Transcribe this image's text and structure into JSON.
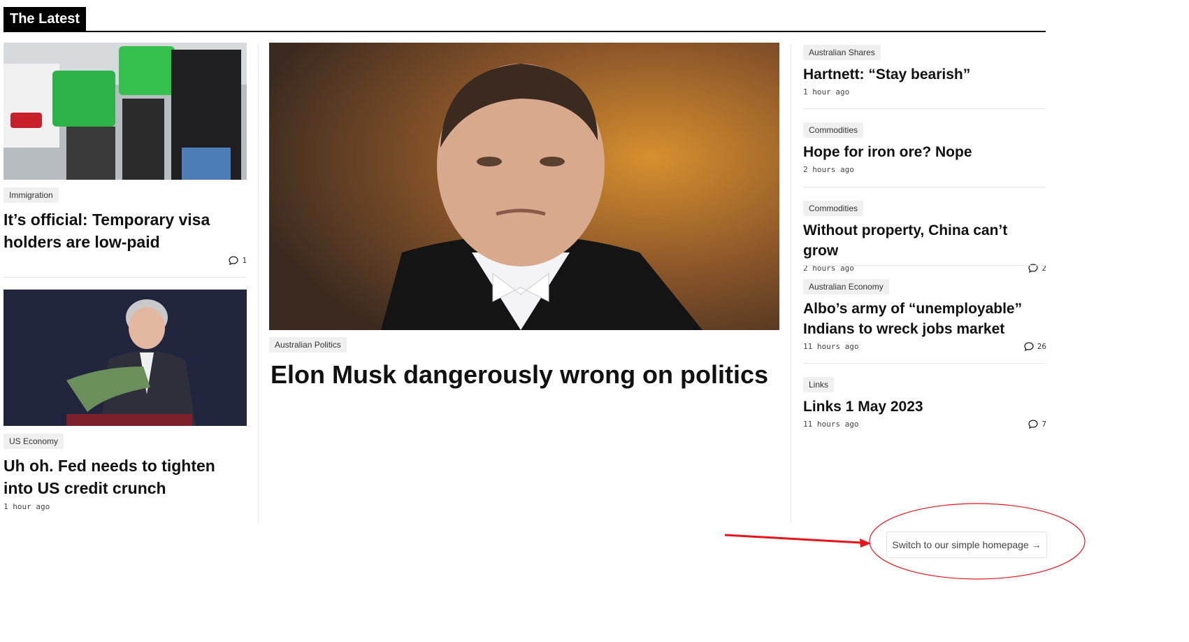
{
  "section": {
    "title": "The Latest"
  },
  "left": [
    {
      "tag": "Immigration",
      "headline": "It’s official: Temporary visa holders are low-paid",
      "comments": "1"
    },
    {
      "tag": "US Economy",
      "headline": "Uh oh. Fed needs to tighten into US credit crunch",
      "time": "1 hour ago"
    }
  ],
  "main": {
    "tag": "Australian Politics",
    "headline": "Elon Musk dangerously wrong on politics"
  },
  "right": [
    {
      "tag": "Australian Shares",
      "headline": "Hartnett: “Stay bearish”",
      "time": "1 hour ago"
    },
    {
      "tag": "Commodities",
      "headline": "Hope for iron ore? Nope",
      "time": "2 hours ago"
    },
    {
      "tag": "Commodities",
      "headline": "Without property, China can’t grow",
      "time": "2 hours ago",
      "comments": "2"
    },
    {
      "tag": "Australian Economy",
      "headline": "Albo’s army of “unemployable” Indians to wreck jobs market",
      "time": "11 hours ago",
      "comments": "26"
    },
    {
      "tag": "Links",
      "headline": "Links 1 May 2023",
      "time": "11 hours ago",
      "comments": "7"
    }
  ],
  "switch_label": "Switch to our simple homepage →",
  "colors": {
    "annotation": "#e8141a",
    "tag_bg": "#f0f0f0",
    "rule": "#000000"
  }
}
